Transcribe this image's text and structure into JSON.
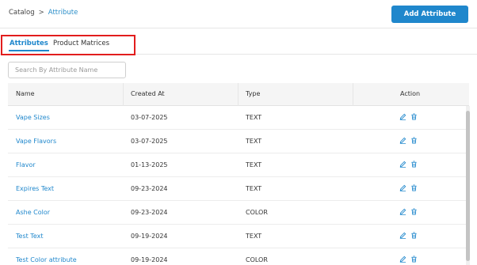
{
  "breadcrumb": {
    "root": "Catalog",
    "separator": ">",
    "current": "Attribute"
  },
  "header": {
    "add_button_label": "Add Attribute",
    "accent_color": "#1f87cc"
  },
  "tabs": [
    {
      "label": "Attributes",
      "active": true
    },
    {
      "label": "Product Matrices",
      "active": false
    }
  ],
  "search": {
    "placeholder": "Search By Attribute Name",
    "value": ""
  },
  "table": {
    "columns": [
      "Name",
      "Created At",
      "Type",
      "Action"
    ],
    "rows": [
      {
        "name": "Vape Sizes",
        "created_at": "03-07-2025",
        "type": "TEXT"
      },
      {
        "name": "Vape Flavors",
        "created_at": "03-07-2025",
        "type": "TEXT"
      },
      {
        "name": "Flavor",
        "created_at": "01-13-2025",
        "type": "TEXT"
      },
      {
        "name": "Expires Text",
        "created_at": "09-23-2024",
        "type": "TEXT"
      },
      {
        "name": "Ashe Color",
        "created_at": "09-23-2024",
        "type": "COLOR"
      },
      {
        "name": "Test Text",
        "created_at": "09-19-2024",
        "type": "TEXT"
      },
      {
        "name": "Test Color attribute",
        "created_at": "09-19-2024",
        "type": "COLOR"
      }
    ],
    "action_icons": [
      "edit-icon",
      "trash-icon"
    ]
  },
  "annotation_color": "#e21d1d"
}
